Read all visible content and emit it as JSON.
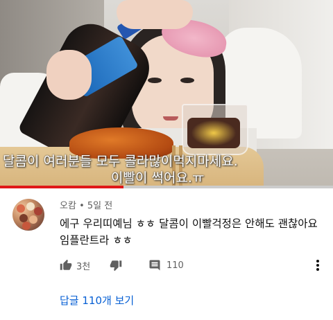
{
  "video": {
    "subtitle_line1": "달콤이 여러분들 모두 콜라많이먹지마세요.",
    "subtitle_line2": "이빨이 썩어요.ㅠ",
    "progress_percent": 37,
    "progress_color": "#e01818"
  },
  "comment": {
    "author": "오캄",
    "separator": "•",
    "time": "5일 전",
    "text_line1": "에구 우리띠예님 ㅎㅎ 달콤이 이빨걱정은 안해도 괜찮아요",
    "text_line2": "임플란트라 ㅎㅎ",
    "like_count": "3천",
    "reply_count": "110",
    "replies_link": "답글 110개 보기",
    "icons": [
      "like-icon",
      "dislike-icon",
      "reply-icon",
      "more-vert-icon"
    ]
  },
  "colors": {
    "link": "#065fd4",
    "meta": "#606060",
    "text": "#0f0f0f"
  }
}
